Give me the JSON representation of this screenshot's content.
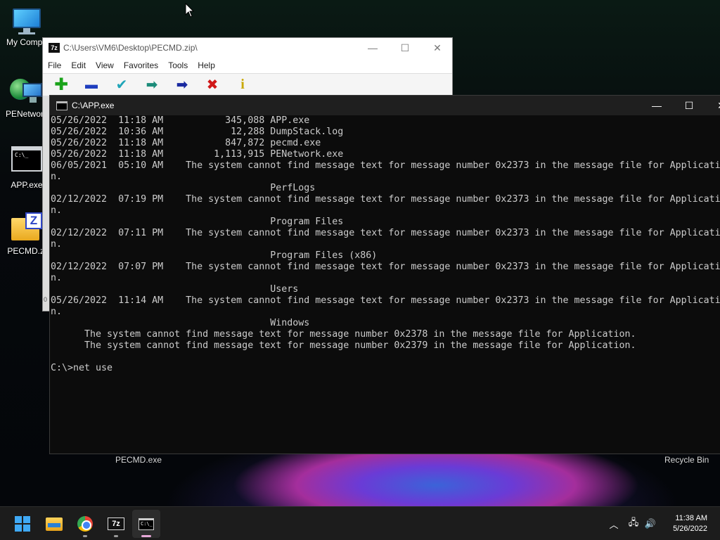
{
  "desktop": {
    "icons": [
      {
        "label": "My Compu"
      },
      {
        "label": "PENetwork"
      },
      {
        "label": "APP.exe"
      },
      {
        "label": "PECMD.zi"
      }
    ],
    "wallpaper_labels": {
      "pecmd": "PECMD.exe",
      "recycle": "Recycle Bin"
    }
  },
  "zip_window": {
    "title": "C:\\Users\\VM6\\Desktop\\PECMD.zip\\",
    "app_icon": "7z",
    "menu": [
      "File",
      "Edit",
      "View",
      "Favorites",
      "Tools",
      "Help"
    ],
    "toolbar": [
      {
        "name": "add-icon",
        "glyph": "✚",
        "color": "#1aa31a"
      },
      {
        "name": "extract-icon",
        "glyph": "▬",
        "color": "#1f3fbf"
      },
      {
        "name": "test-icon",
        "glyph": "✔",
        "color": "#1fa5b8"
      },
      {
        "name": "copy-icon",
        "glyph": "➡",
        "color": "#1c8c7a"
      },
      {
        "name": "move-icon",
        "glyph": "➡",
        "color": "#1a2aa0"
      },
      {
        "name": "delete-icon",
        "glyph": "✖",
        "color": "#d01818"
      },
      {
        "name": "info-icon",
        "glyph": "i",
        "color": "#c9a800"
      }
    ],
    "side_text": "0"
  },
  "cmd_window": {
    "title": "C:\\APP.exe",
    "lines": [
      "05/26/2022  11:18 AM           345,088 APP.exe",
      "05/26/2022  10:36 AM            12,288 DumpStack.log",
      "05/26/2022  11:18 AM           847,872 pecmd.exe",
      "05/26/2022  11:18 AM         1,113,915 PENetwork.exe",
      "06/05/2021  05:10 AM    The system cannot find message text for message number 0x2373 in the message file for Applicatio",
      "n.",
      "                                       PerfLogs",
      "02/12/2022  07:19 PM    The system cannot find message text for message number 0x2373 in the message file for Applicatio",
      "n.",
      "                                       Program Files",
      "02/12/2022  07:11 PM    The system cannot find message text for message number 0x2373 in the message file for Applicatio",
      "n.",
      "                                       Program Files (x86)",
      "02/12/2022  07:07 PM    The system cannot find message text for message number 0x2373 in the message file for Applicatio",
      "n.",
      "                                       Users",
      "05/26/2022  11:14 AM    The system cannot find message text for message number 0x2373 in the message file for Applicatio",
      "n.",
      "                                       Windows",
      "      The system cannot find message text for message number 0x2378 in the message file for Application.",
      "      The system cannot find message text for message number 0x2379 in the message file for Application.",
      "",
      "C:\\>net use"
    ]
  },
  "taskbar": {
    "apps": [
      {
        "name": "start-button"
      },
      {
        "name": "file-explorer"
      },
      {
        "name": "chrome"
      },
      {
        "name": "7zip",
        "glyph": "7z"
      },
      {
        "name": "command-prompt",
        "glyph": "C:\\_"
      }
    ],
    "tray": {
      "chevron": "︿",
      "network": "🖧",
      "volume": "🔊"
    },
    "clock": {
      "time": "11:38 AM",
      "date": "5/26/2022"
    }
  }
}
